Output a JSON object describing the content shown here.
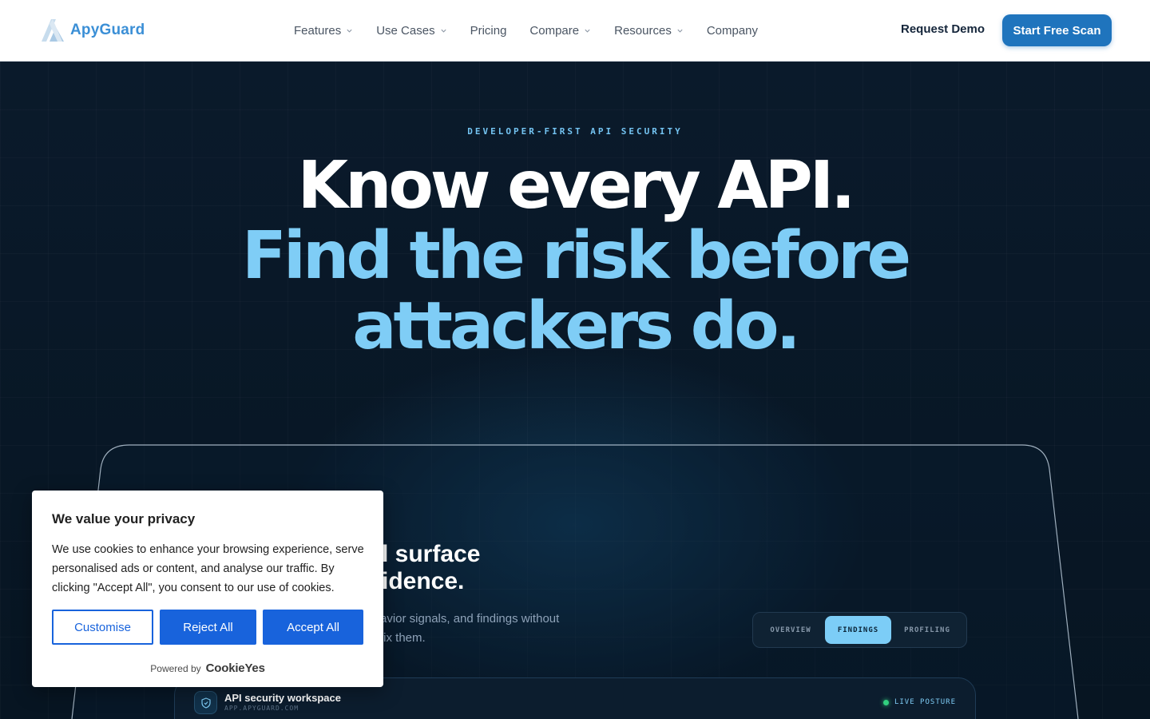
{
  "brand": {
    "name": "ApyGuard",
    "color": "#3b8fd6"
  },
  "nav": {
    "items": [
      {
        "label": "Features",
        "has_dropdown": true
      },
      {
        "label": "Use Cases",
        "has_dropdown": true
      },
      {
        "label": "Pricing",
        "has_dropdown": false
      },
      {
        "label": "Compare",
        "has_dropdown": true
      },
      {
        "label": "Resources",
        "has_dropdown": true
      },
      {
        "label": "Company",
        "has_dropdown": false
      }
    ],
    "request_demo": "Request Demo",
    "start_scan": "Start Free Scan"
  },
  "hero": {
    "eyebrow": "DEVELOPER-FIRST API SECURITY",
    "line1": "Know every API.",
    "line2": "Find the risk before",
    "line3": "attackers do."
  },
  "panel": {
    "title_line1": "l surface",
    "title_line2": "idence.",
    "desc_line1": "avior signals, and findings without",
    "desc_line2": "fix them.",
    "tabs": [
      {
        "label": "OVERVIEW",
        "active": false
      },
      {
        "label": "FINDINGS",
        "active": true
      },
      {
        "label": "PROFILING",
        "active": false
      }
    ]
  },
  "workspace": {
    "title": "API security workspace",
    "subtitle": "APP.APYGUARD.COM",
    "status": "LIVE POSTURE",
    "icon": "shield-icon"
  },
  "cookie": {
    "title": "We value your privacy",
    "text": "We use cookies to enhance your browsing experience, serve personalised ads or content, and analyse our traffic. By clicking \"Accept All\", you consent to our use of cookies.",
    "customise": "Customise",
    "reject": "Reject All",
    "accept": "Accept All",
    "powered_by": "Powered by",
    "powered_brand": "CookieYes"
  },
  "colors": {
    "accent": "#1f74bd",
    "hero_highlight": "#7fcdf6",
    "cookie_primary": "#1863dc"
  }
}
